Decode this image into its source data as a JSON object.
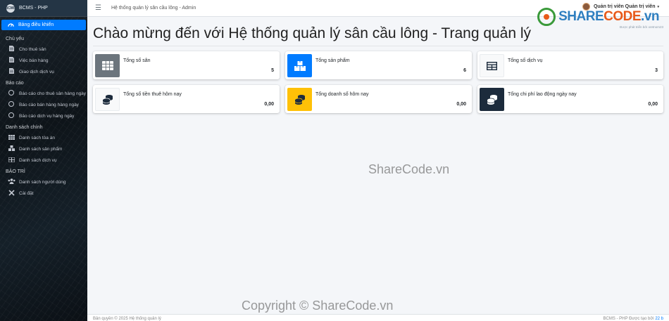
{
  "brand": {
    "name": "BCMS - PHP",
    "logo_text": "BCMS"
  },
  "sidebar": {
    "active_item": {
      "label": "Bảng điều khiển",
      "icon": "tachometer-icon"
    },
    "sections": [
      {
        "header": "Chủ yếu",
        "items": [
          {
            "label": "Cho thuê sân",
            "icon": "file-icon"
          },
          {
            "label": "Việc bán hàng",
            "icon": "file-icon"
          },
          {
            "label": "Giao dịch dịch vụ",
            "icon": "file-icon"
          }
        ]
      },
      {
        "header": "Báo cáo",
        "items": [
          {
            "label": "Báo cáo cho thuê sân hàng ngày",
            "icon": "circle-icon"
          },
          {
            "label": "Báo cáo bán hàng hàng ngày",
            "icon": "circle-icon"
          },
          {
            "label": "Báo cáo dịch vụ hàng ngày",
            "icon": "circle-icon"
          }
        ]
      },
      {
        "header": "Danh sách chính",
        "items": [
          {
            "label": "Danh sách tòa án",
            "icon": "table-icon"
          },
          {
            "label": "Danh sách sản phẩm",
            "icon": "boxes-icon"
          },
          {
            "label": "Danh sách dịch vụ",
            "icon": "grid-icon"
          }
        ]
      },
      {
        "header": "BẢO TRÌ",
        "items": [
          {
            "label": "Danh sách người dùng",
            "icon": "users-icon"
          },
          {
            "label": "Cài đặt",
            "icon": "tools-icon"
          }
        ]
      }
    ]
  },
  "topbar": {
    "menu_icon": "hamburger-icon",
    "title": "Hệ thống quản lý sân cầu lông - Admin",
    "user_name": "Quản trị viên Quản trị viên",
    "caret": "▾"
  },
  "watermark": {
    "logo_share": "SHARE",
    "logo_code": "CODE",
    "logo_tld": ".vn",
    "subtext": "Được phát triển bởi oretnom23",
    "center": "ShareCode.vn",
    "copyright": "Copyright © ShareCode.vn"
  },
  "main": {
    "title": "Chào mừng đến với Hệ thống quản lý sân cầu lông - Trang quản lý",
    "cards": [
      {
        "label": "Tổng số sân",
        "value": "5",
        "icon": "table-icon",
        "color": "#6c757d"
      },
      {
        "label": "Tổng sản phẩm",
        "value": "6",
        "icon": "boxes-icon",
        "color": "#007bff"
      },
      {
        "label": "Tổng số dịch vụ",
        "value": "3",
        "icon": "grid-icon",
        "color": "#f8f9fa"
      },
      {
        "label": "Tổng số tiền thuê hôm nay",
        "value": "0,00",
        "icon": "coins-icon",
        "color": "#f8f9fa"
      },
      {
        "label": "Tổng doanh số hôm nay",
        "value": "0,00",
        "icon": "coins-icon",
        "color": "#ffc107"
      },
      {
        "label": "Tổng chi phí lao động ngày nay",
        "value": "0,00",
        "icon": "coins-icon",
        "color": "#1c2b3c"
      }
    ]
  },
  "footer": {
    "left": "Bản quyền © 2025 Hệ thống quản lý",
    "right_prefix": "BCMS - PHP Được tạo bởi",
    "right_link": "22 b"
  }
}
